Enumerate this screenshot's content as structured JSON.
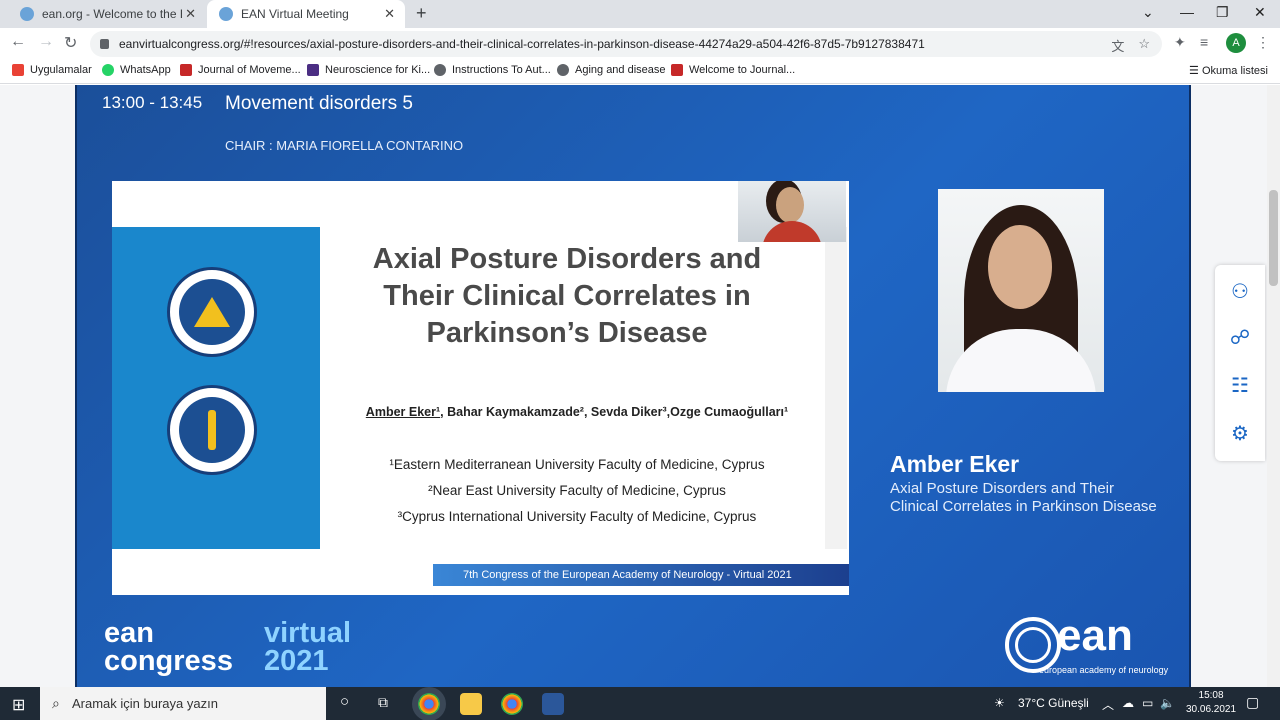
{
  "tabs": [
    {
      "title": "ean.org - Welcome to the European",
      "close": "✕"
    },
    {
      "title": "EAN Virtual Meeting",
      "close": "✕"
    }
  ],
  "new_tab": "+",
  "window": {
    "minimize": "—",
    "maximize": "❐",
    "close": "✕",
    "menu": "⌄"
  },
  "toolbar": {
    "back": "←",
    "forward": "→",
    "reload": "↻",
    "url": "eanvirtualcongress.org/#!resources/axial-posture-disorders-and-their-clinical-correlates-in-parkinson-disease-44274a29-a504-42f6-87d5-7b9127838471",
    "profile_initial": "A"
  },
  "bookmarks": [
    {
      "label": "Uygulamalar",
      "color": "#e94235"
    },
    {
      "label": "WhatsApp",
      "color": "#25d366"
    },
    {
      "label": "Journal of Moveme...",
      "color": "#c62828"
    },
    {
      "label": "Neuroscience for Ki...",
      "color": "#4b2e83"
    },
    {
      "label": "Instructions To Aut...",
      "color": "#5f6368"
    },
    {
      "label": "Aging and disease",
      "color": "#5f6368"
    },
    {
      "label": "Welcome to Journal...",
      "color": "#c62828"
    }
  ],
  "reading_list": "Okuma listesi",
  "session": {
    "time": "13:00 - 13:45",
    "title": "Movement disorders 5",
    "chair": "CHAIR : MARIA FIORELLA CONTARINO"
  },
  "slide": {
    "title_lines": [
      "Axial Posture Disorders and",
      "Their Clinical Correlates in",
      "Parkinson’s Disease"
    ],
    "presenter_author": "Amber Eker¹",
    "other_authors": ", Bahar Kaymakamzade², Sevda Diker³,Ozge Cumaoğulları¹",
    "affiliations": [
      "¹Eastern Mediterranean University Faculty of Medicine, Cyprus",
      "²Near East University Faculty of Medicine, Cyprus",
      "³Cyprus International University Faculty of Medicine, Cyprus"
    ],
    "footer": "7th Congress of the European Academy of Neurology - Virtual 2021"
  },
  "speaker": {
    "name": "Amber Eker",
    "talk": "Axial Posture Disorders and Their Clinical Correlates in Parkinson Disease"
  },
  "branding": {
    "left_line1": "ean",
    "left_line2": "congress",
    "virtual_line1": "virtual",
    "virtual_line2": "2021",
    "logo_word": "ean",
    "logo_sub": "european academy of neurology"
  },
  "side_panel": [
    {
      "icon": "participants-icon",
      "glyph": "👥"
    },
    {
      "icon": "chat-icon",
      "glyph": "💬"
    },
    {
      "icon": "agenda-icon",
      "glyph": "📋"
    },
    {
      "icon": "settings-icon",
      "glyph": "⚙"
    }
  ],
  "taskbar": {
    "search_placeholder": "Aramak için buraya yazın",
    "weather": "37°C  Güneşli",
    "time": "15:08",
    "date": "30.06.2021"
  }
}
